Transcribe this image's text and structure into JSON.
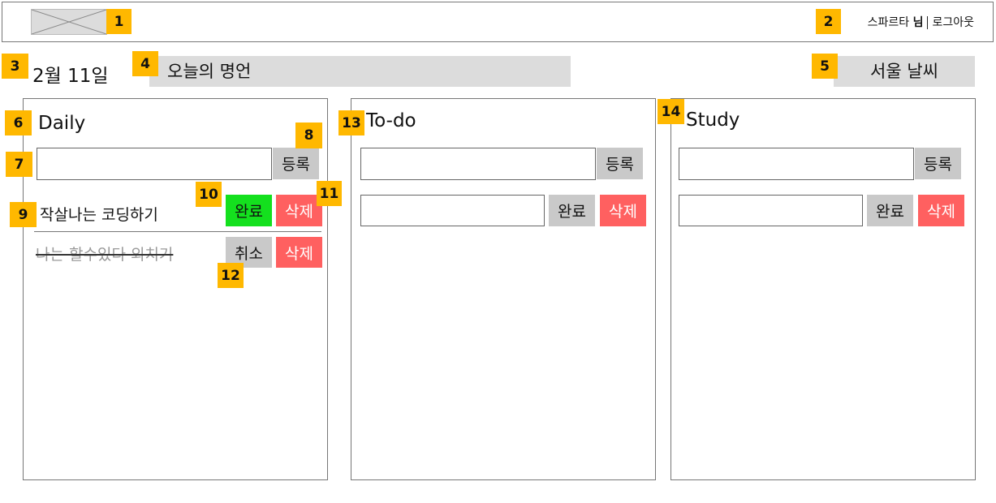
{
  "header": {
    "user_name": "스파르타",
    "user_suffix": "님",
    "logout_label": "로그아웃"
  },
  "top": {
    "date": "2월 11일",
    "quote_label": "오늘의 명언",
    "weather_label": "서울 날씨"
  },
  "panels": {
    "daily": {
      "title": "Daily",
      "register_label": "등록",
      "items": [
        {
          "text": "작살나는 코딩하기",
          "action_label": "완료",
          "delete_label": "삭제"
        },
        {
          "text": "나는 할수있다 외치기",
          "action_label": "취소",
          "delete_label": "삭제"
        }
      ]
    },
    "todo": {
      "title": "To-do",
      "register_label": "등록",
      "complete_label": "완료",
      "delete_label": "삭제"
    },
    "study": {
      "title": "Study",
      "register_label": "등록",
      "complete_label": "완료",
      "delete_label": "삭제"
    }
  },
  "annotations": [
    "1",
    "2",
    "3",
    "4",
    "5",
    "6",
    "7",
    "8",
    "9",
    "10",
    "11",
    "12",
    "13",
    "14"
  ],
  "colors": {
    "badge": "#FFB800",
    "complete_button": "#14e01e",
    "delete_button": "#ff6060",
    "neutral_button": "#c9c9c9",
    "placeholder_block": "#dcdcdc"
  }
}
